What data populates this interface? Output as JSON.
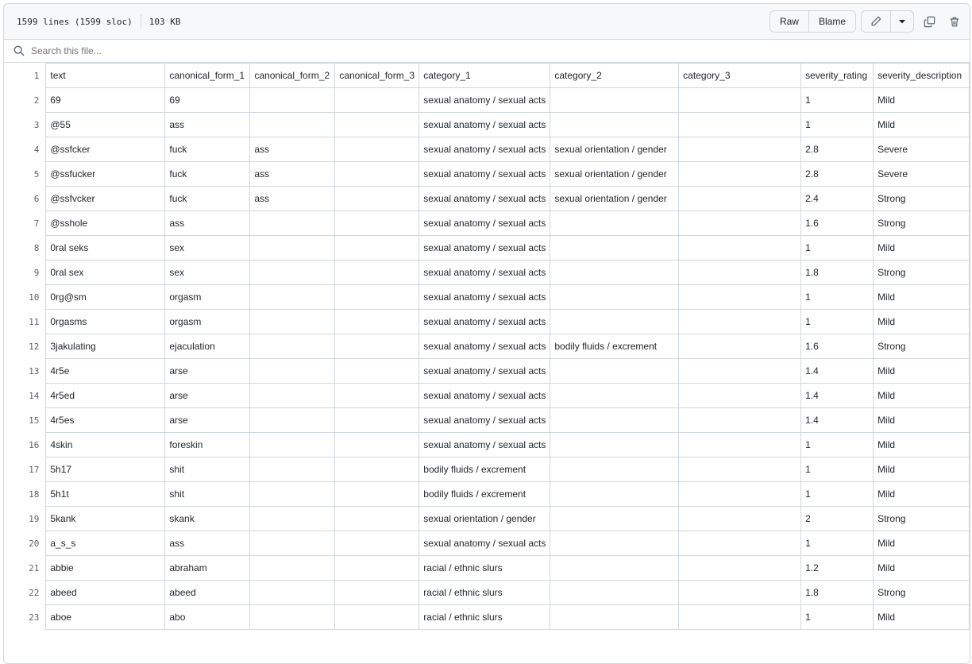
{
  "header": {
    "lines": "1599 lines (1599 sloc)",
    "size": "103 KB",
    "raw_label": "Raw",
    "blame_label": "Blame"
  },
  "search": {
    "placeholder": "Search this file..."
  },
  "table": {
    "first_line": "1",
    "columns": [
      "text",
      "canonical_form_1",
      "canonical_form_2",
      "canonical_form_3",
      "category_1",
      "category_2",
      "category_3",
      "severity_rating",
      "severity_description"
    ],
    "rows": [
      [
        "2",
        "69",
        "69",
        "",
        "",
        "sexual anatomy / sexual acts",
        "",
        "",
        "1",
        "Mild"
      ],
      [
        "3",
        "@55",
        "ass",
        "",
        "",
        "sexual anatomy / sexual acts",
        "",
        "",
        "1",
        "Mild"
      ],
      [
        "4",
        "@ssfcker",
        "fuck",
        "ass",
        "",
        "sexual anatomy / sexual acts",
        "sexual orientation / gender",
        "",
        "2.8",
        "Severe"
      ],
      [
        "5",
        "@ssfucker",
        "fuck",
        "ass",
        "",
        "sexual anatomy / sexual acts",
        "sexual orientation / gender",
        "",
        "2.8",
        "Severe"
      ],
      [
        "6",
        "@ssfvcker",
        "fuck",
        "ass",
        "",
        "sexual anatomy / sexual acts",
        "sexual orientation / gender",
        "",
        "2.4",
        "Strong"
      ],
      [
        "7",
        "@sshole",
        "ass",
        "",
        "",
        "sexual anatomy / sexual acts",
        "",
        "",
        "1.6",
        "Strong"
      ],
      [
        "8",
        "0ral seks",
        "sex",
        "",
        "",
        "sexual anatomy / sexual acts",
        "",
        "",
        "1",
        "Mild"
      ],
      [
        "9",
        "0ral sex",
        "sex",
        "",
        "",
        "sexual anatomy / sexual acts",
        "",
        "",
        "1.8",
        "Strong"
      ],
      [
        "10",
        "0rg@sm",
        "orgasm",
        "",
        "",
        "sexual anatomy / sexual acts",
        "",
        "",
        "1",
        "Mild"
      ],
      [
        "11",
        "0rgasms",
        "orgasm",
        "",
        "",
        "sexual anatomy / sexual acts",
        "",
        "",
        "1",
        "Mild"
      ],
      [
        "12",
        "3jakulating",
        "ejaculation",
        "",
        "",
        "sexual anatomy / sexual acts",
        "bodily fluids / excrement",
        "",
        "1.6",
        "Strong"
      ],
      [
        "13",
        "4r5e",
        "arse",
        "",
        "",
        "sexual anatomy / sexual acts",
        "",
        "",
        "1.4",
        "Mild"
      ],
      [
        "14",
        "4r5ed",
        "arse",
        "",
        "",
        "sexual anatomy / sexual acts",
        "",
        "",
        "1.4",
        "Mild"
      ],
      [
        "15",
        "4r5es",
        "arse",
        "",
        "",
        "sexual anatomy / sexual acts",
        "",
        "",
        "1.4",
        "Mild"
      ],
      [
        "16",
        "4skin",
        "foreskin",
        "",
        "",
        "sexual anatomy / sexual acts",
        "",
        "",
        "1",
        "Mild"
      ],
      [
        "17",
        "5h17",
        "shit",
        "",
        "",
        "bodily fluids / excrement",
        "",
        "",
        "1",
        "Mild"
      ],
      [
        "18",
        "5h1t",
        "shit",
        "",
        "",
        "bodily fluids / excrement",
        "",
        "",
        "1",
        "Mild"
      ],
      [
        "19",
        "5kank",
        "skank",
        "",
        "",
        "sexual orientation / gender",
        "",
        "",
        "2",
        "Strong"
      ],
      [
        "20",
        "a_s_s",
        "ass",
        "",
        "",
        "sexual anatomy / sexual acts",
        "",
        "",
        "1",
        "Mild"
      ],
      [
        "21",
        "abbie",
        "abraham",
        "",
        "",
        "racial / ethnic slurs",
        "",
        "",
        "1.2",
        "Mild"
      ],
      [
        "22",
        "abeed",
        "abeed",
        "",
        "",
        "racial / ethnic slurs",
        "",
        "",
        "1.8",
        "Strong"
      ],
      [
        "23",
        "aboe",
        "abo",
        "",
        "",
        "racial / ethnic slurs",
        "",
        "",
        "1",
        "Mild"
      ]
    ]
  }
}
